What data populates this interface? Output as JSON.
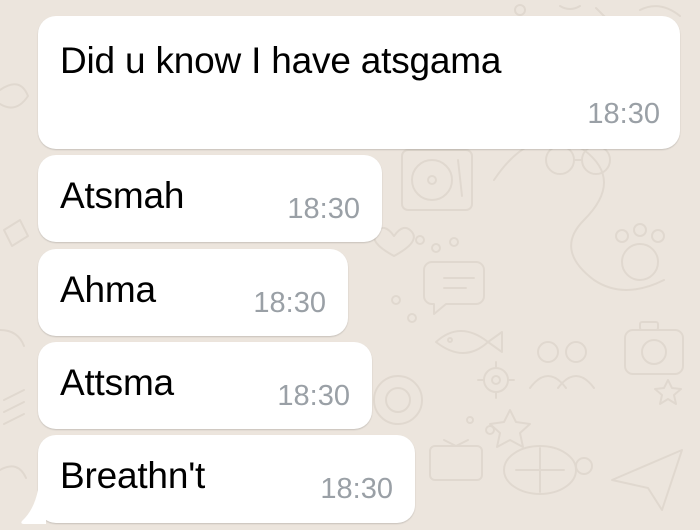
{
  "chat": {
    "background": "#ece5dd",
    "bubble_color": "#ffffff",
    "time_color": "#9aa0a6",
    "messages": [
      {
        "text": "Did u know I have atsgama",
        "time": "18:30"
      },
      {
        "text": "Atsmah",
        "time": "18:30"
      },
      {
        "text": "Ahma",
        "time": "18:30"
      },
      {
        "text": "Attsma",
        "time": "18:30"
      },
      {
        "text": "Breathn't",
        "time": "18:30"
      }
    ]
  }
}
